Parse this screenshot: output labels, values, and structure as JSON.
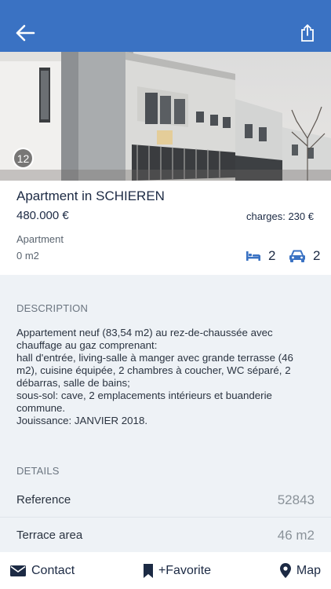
{
  "header": {
    "back_icon": "arrow-left-icon",
    "share_icon": "share-icon"
  },
  "gallery": {
    "photo_count": "12"
  },
  "listing": {
    "title": "Apartment in SCHIEREN",
    "price": "480.000 €",
    "charges": "charges: 230 €",
    "property_type": "Apartment",
    "area": "0 m2",
    "bedrooms": "2",
    "parking": "2"
  },
  "description": {
    "heading": "DESCRIPTION",
    "text": "Appartement neuf (83,54 m2) au rez-de-chaussée avec\nchauffage au gaz comprenant:\nhall d'entrée, living-salle à manger avec grande terrasse (46\nm2), cuisine équipée, 2 chambres à coucher, WC séparé, 2\ndébarras, salle de bains;\nsous-sol: cave, 2 emplacements intérieurs et buanderie\ncommune.\nJouissance: JANVIER 2018."
  },
  "details": {
    "heading": "DETAILS",
    "rows": [
      {
        "label": "Reference",
        "value": "52843"
      },
      {
        "label": "Terrace area",
        "value": "46 m2"
      }
    ]
  },
  "tabbar": {
    "contact_label": "Contact",
    "favorite_label": "+Favorite",
    "map_label": "Map"
  },
  "colors": {
    "header_blue": "#3a72c3",
    "icon_blue": "#3a72c3",
    "navy": "#1c2a44"
  }
}
